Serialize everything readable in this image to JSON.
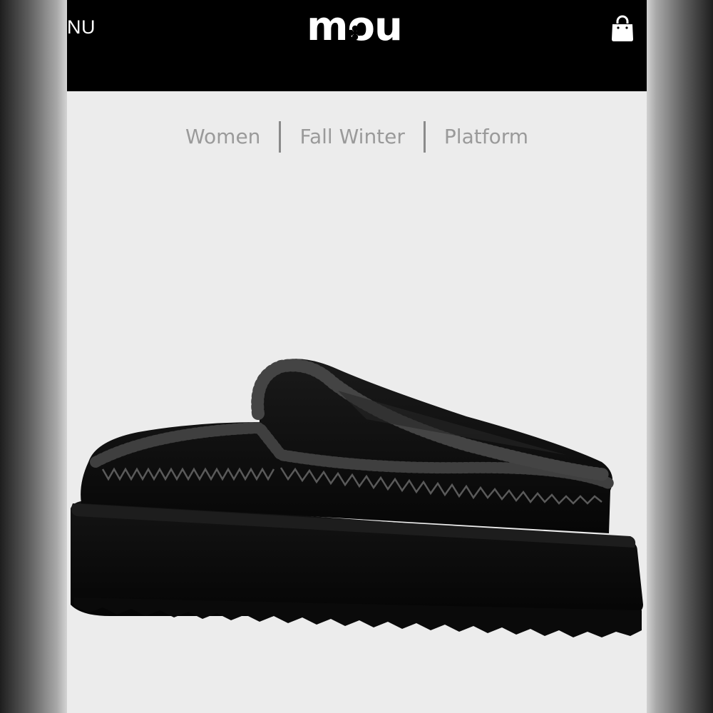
{
  "header": {
    "menu_label": "NU",
    "logo_text": "mou",
    "cart_icon": "shopping-bag-icon"
  },
  "breadcrumb": {
    "items": [
      "Women",
      "Fall Winter",
      "Platform"
    ]
  },
  "product": {
    "image_icon": "platform-clog-image",
    "color": "#0c0c0c",
    "stitch_color": "#5a5a5a"
  },
  "colors": {
    "topbar": "#000000",
    "page_background": "#ececec",
    "breadcrumb_text": "#9a9a9a"
  }
}
